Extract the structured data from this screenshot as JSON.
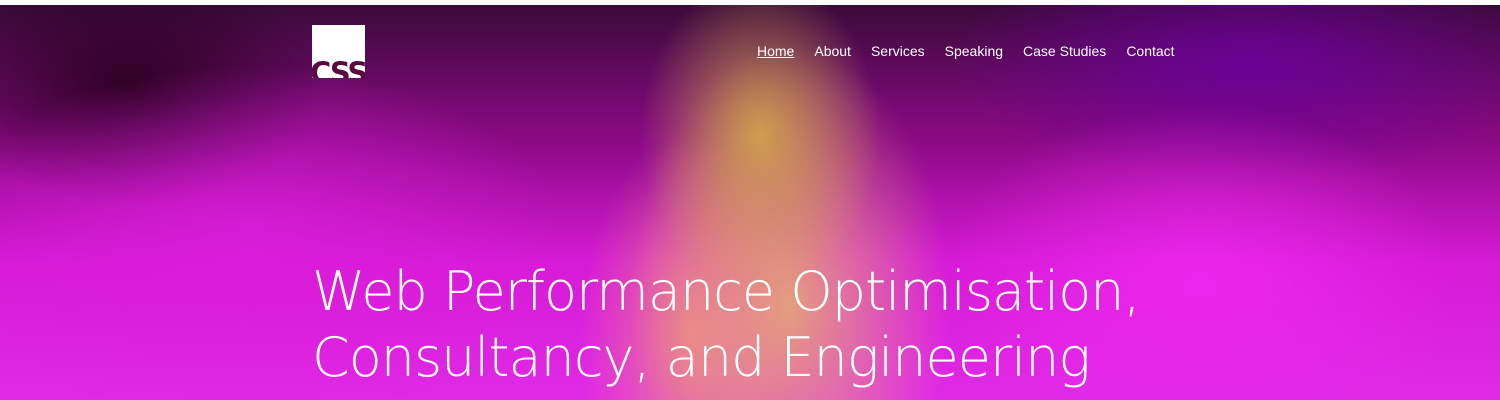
{
  "site": {
    "logo_text": "CSS"
  },
  "nav": {
    "items": [
      {
        "label": "Home",
        "active": true
      },
      {
        "label": "About"
      },
      {
        "label": "Services"
      },
      {
        "label": "Speaking"
      },
      {
        "label": "Case Studies"
      },
      {
        "label": "Contact"
      }
    ]
  },
  "hero": {
    "headline_line1": "Web Performance Optimisation,",
    "headline_line2": "Consultancy, and Engineering"
  },
  "colors": {
    "text": "#ffffff",
    "logo_bg": "#ffffff"
  }
}
